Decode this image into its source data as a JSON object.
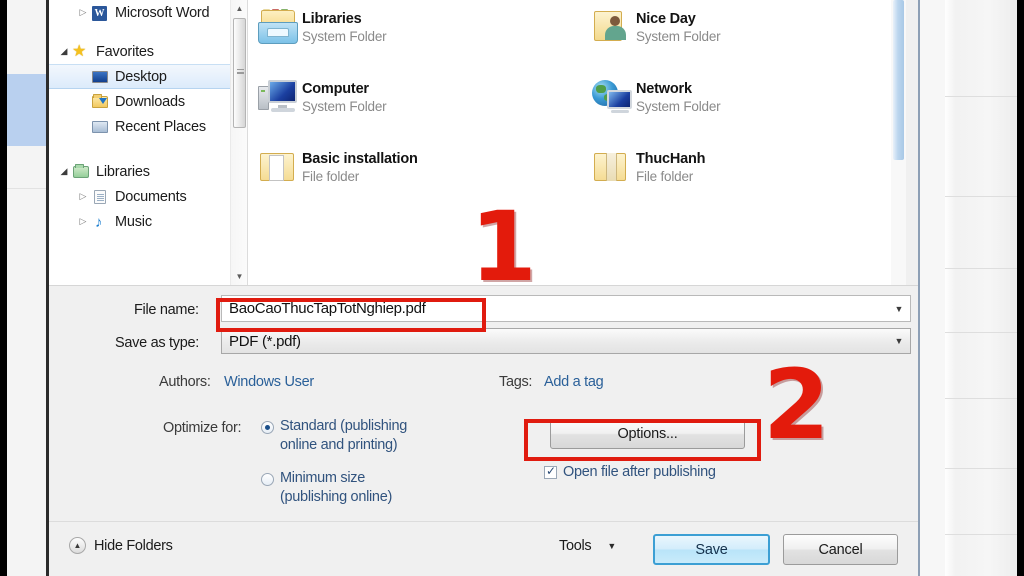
{
  "dialog": {
    "nav_tree": [
      {
        "label": "Microsoft Word",
        "icon": "word-icon",
        "twisty": "collapsed",
        "indent": 1,
        "selected": false
      },
      {
        "label": "Favorites",
        "icon": "star-icon",
        "twisty": "expanded",
        "indent": 0,
        "selected": false
      },
      {
        "label": "Desktop",
        "icon": "desktop-icon",
        "twisty": "none",
        "indent": 1,
        "selected": true
      },
      {
        "label": "Downloads",
        "icon": "downloads-folder-icon",
        "twisty": "none",
        "indent": 1,
        "selected": false
      },
      {
        "label": "Recent Places",
        "icon": "recent-places-icon",
        "twisty": "none",
        "indent": 1,
        "selected": false
      },
      {
        "label": "Libraries",
        "icon": "libraries-icon",
        "twisty": "expanded",
        "indent": 0,
        "selected": false
      },
      {
        "label": "Documents",
        "icon": "documents-icon",
        "twisty": "collapsed",
        "indent": 1,
        "selected": false
      },
      {
        "label": "Music",
        "icon": "music-icon",
        "twisty": "collapsed",
        "indent": 1,
        "selected": false
      }
    ],
    "file_list": [
      {
        "name": "Libraries",
        "type": "System Folder",
        "icon": "libraries-folder-icon"
      },
      {
        "name": "Nice Day",
        "type": "System Folder",
        "icon": "user-folder-icon"
      },
      {
        "name": "Computer",
        "type": "System Folder",
        "icon": "computer-icon"
      },
      {
        "name": "Network",
        "type": "System Folder",
        "icon": "network-icon"
      },
      {
        "name": "Basic installation",
        "type": "File folder",
        "icon": "folder-open-icon"
      },
      {
        "name": "ThucHanh",
        "type": "File folder",
        "icon": "folder-icon"
      }
    ],
    "form": {
      "file_name_label": "File name:",
      "file_name_value": "BaoCaoThucTapTotNghiep.pdf",
      "save_as_type_label": "Save as type:",
      "save_as_type_value": "PDF (*.pdf)",
      "authors_label": "Authors:",
      "authors_value": "Windows User",
      "tags_label": "Tags:",
      "tags_value": "Add a tag",
      "optimize_label": "Optimize for:",
      "optimize_options": [
        {
          "line1": "Standard (publishing",
          "line2": "online and printing)",
          "selected": true
        },
        {
          "line1": "Minimum size",
          "line2": "(publishing online)",
          "selected": false
        }
      ],
      "options_button": "Options...",
      "open_after_publishing": "Open file after publishing",
      "open_after_publishing_checked": true
    },
    "footer": {
      "hide_folders": "Hide Folders",
      "tools": "Tools",
      "save": "Save",
      "cancel": "Cancel"
    }
  },
  "annotations": {
    "step_one": "1",
    "step_two": "2",
    "color": "#e31b0c"
  },
  "icons": {
    "chevron_down": "▼",
    "chevron_up": "▲",
    "twisty_collapsed": "▷",
    "twisty_expanded": "◢",
    "star": "★",
    "music_note": "♪",
    "word_letter": "W"
  }
}
